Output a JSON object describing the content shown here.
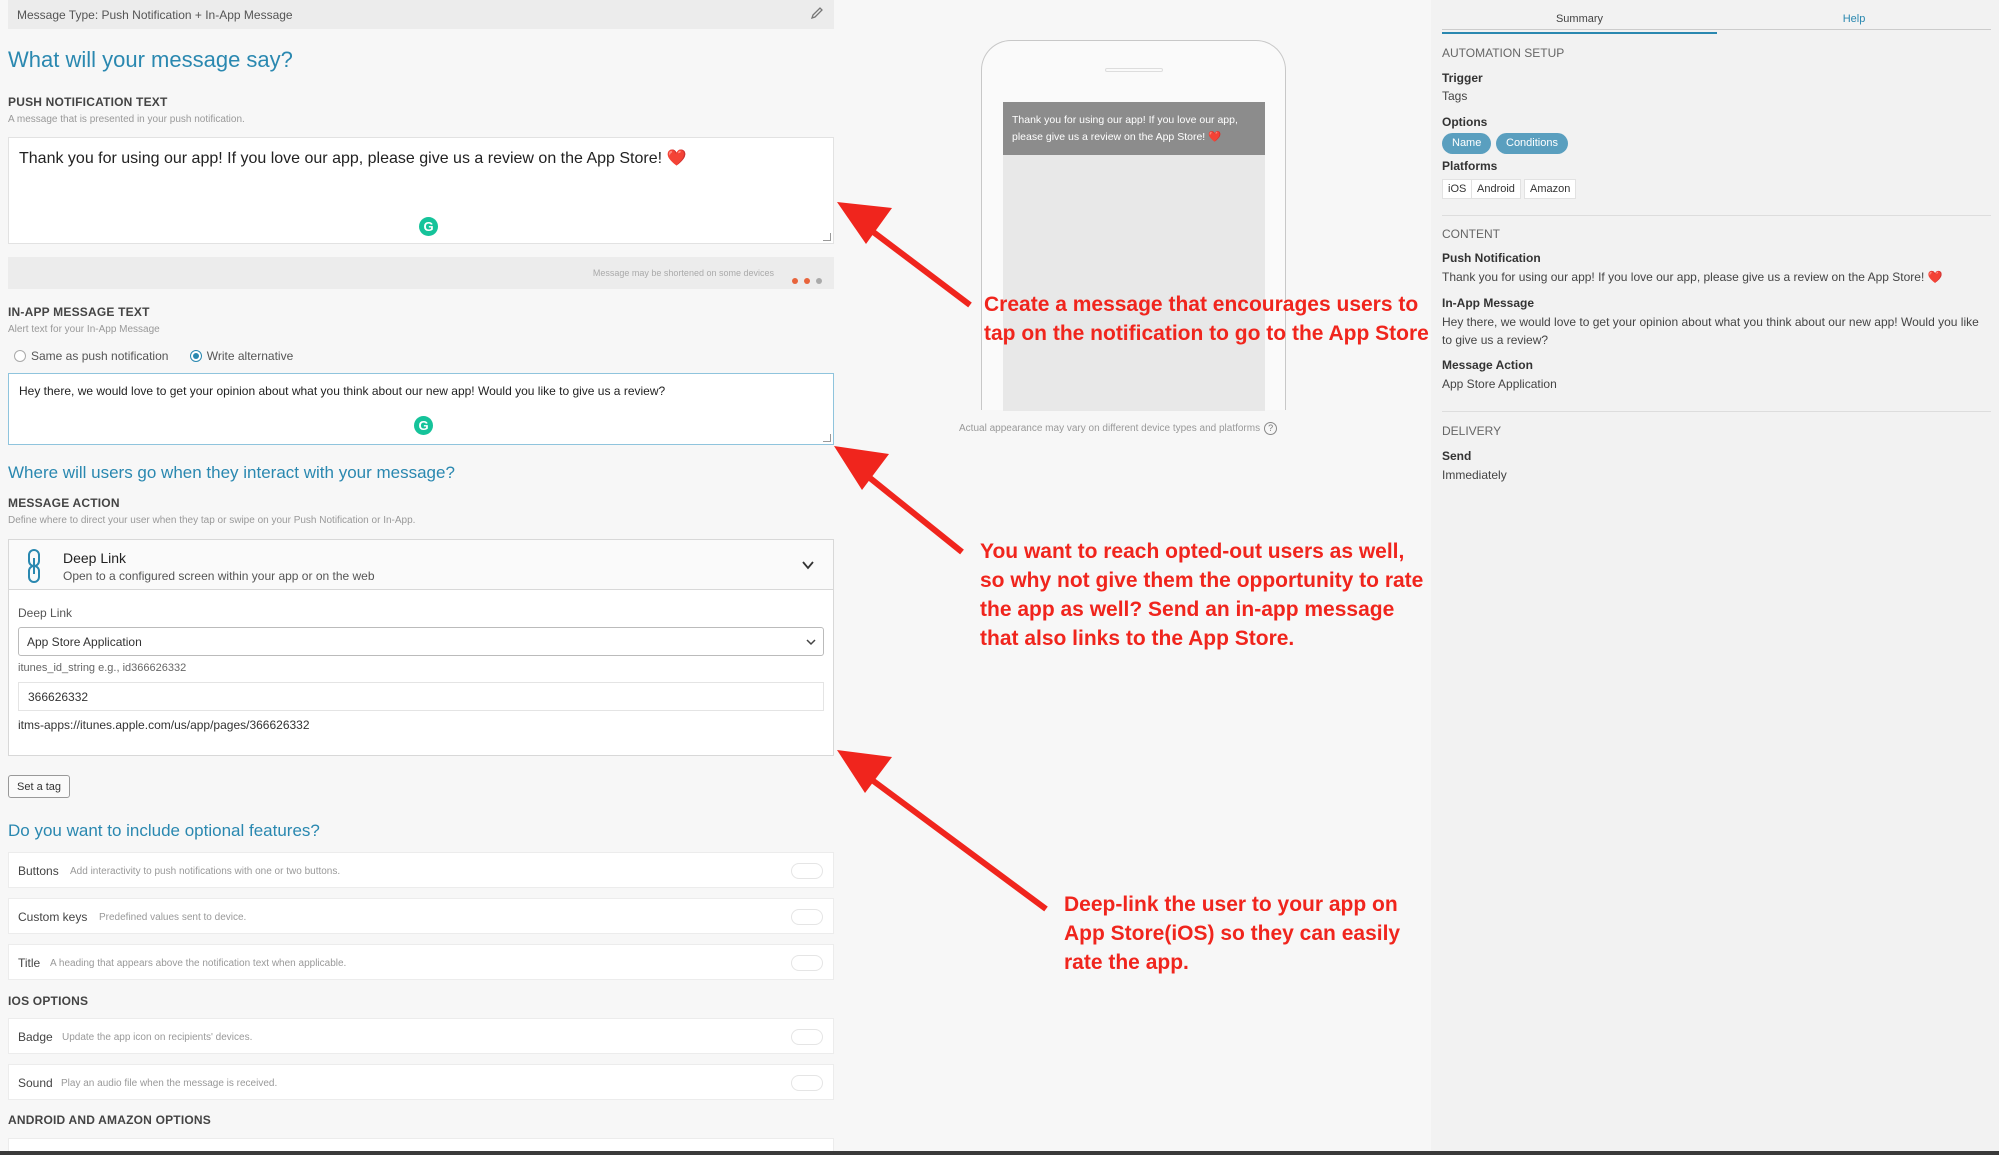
{
  "header": {
    "message_type": "Message Type: Push Notification + In-App Message"
  },
  "main": {
    "title": "What will your message say?",
    "push": {
      "label": "PUSH NOTIFICATION TEXT",
      "hint": "A message that is presented in your push notification.",
      "text": "Thank you for using our app! If you love our app, please give us a review on the App Store! ❤️",
      "shorten_note": "Message may be shortened on some devices"
    },
    "inapp": {
      "label": "IN-APP MESSAGE TEXT",
      "hint": "Alert text for your In-App Message",
      "option_same": "Same as push notification",
      "option_alt": "Write alternative",
      "text": "Hey there, we would love to get your opinion about what you think about our new app! Would you like to give us a review?"
    },
    "where_title": "Where will users go when they interact with your message?",
    "action": {
      "label": "MESSAGE ACTION",
      "hint": "Define where to direct your user when they tap or swipe on your Push Notification or In-App.",
      "type_title": "Deep Link",
      "type_desc": "Open to a configured screen within your app or on the web",
      "deep_link_label": "Deep Link",
      "deep_link_value": "App Store Application",
      "id_hint": "itunes_id_string e.g., id366626332",
      "id_value": "366626332",
      "url": "itms-apps://itunes.apple.com/us/app/pages/366626332"
    },
    "set_tag": "Set a tag",
    "optional_title": "Do you want to include optional features?",
    "features": [
      {
        "name": "Buttons",
        "desc": "Add interactivity to push notifications with one or two buttons."
      },
      {
        "name": "Custom keys",
        "desc": "Predefined values sent to device."
      },
      {
        "name": "Title",
        "desc": "A heading that appears above the notification text when applicable."
      }
    ],
    "ios_label": "IOS OPTIONS",
    "ios_features": [
      {
        "name": "Badge",
        "desc": "Update the app icon on recipients' devices."
      },
      {
        "name": "Sound",
        "desc": "Play an audio file when the message is received."
      }
    ],
    "android_label": "ANDROID AND AMAZON OPTIONS"
  },
  "preview": {
    "notification": "Thank you for using our app! If you love our app, please give us a review on the App Store! ❤️",
    "note": "Actual appearance may vary on different device types and platforms",
    "help_glyph": "?"
  },
  "summary": {
    "tab_summary": "Summary",
    "tab_help": "Help",
    "automation_title": "AUTOMATION SETUP",
    "trigger_label": "Trigger",
    "trigger_value": "Tags",
    "options_label": "Options",
    "options": [
      "Name",
      "Conditions"
    ],
    "platforms_label": "Platforms",
    "platforms": [
      "iOS",
      "Android",
      "Amazon"
    ],
    "content_title": "CONTENT",
    "push_label": "Push Notification",
    "push_value": "Thank you for using our app! If you love our app, please give us a review on the App Store! ❤️",
    "inapp_label": "In-App Message",
    "inapp_value": "Hey there, we would love to get your opinion about what you think about our new app! Would you like to give us a review?",
    "action_label": "Message Action",
    "action_value": "App Store Application",
    "delivery_title": "DELIVERY",
    "send_label": "Send",
    "send_value": "Immediately"
  },
  "annotations": {
    "a1": "Create a message that encourages users to tap on the notification to go to the App Store",
    "a2": "You want to reach opted-out users as well, so why not give them the opportunity to rate the app as well? Send an in-app message that also links to the App Store.",
    "a3": "Deep-link the user to your app on App Store(iOS) so they can easily rate the app."
  },
  "colors": {
    "accent": "#2a88b0",
    "annotation": "#f0251d",
    "grammarly": "#15c39a",
    "pill": "#5a9fbf"
  }
}
